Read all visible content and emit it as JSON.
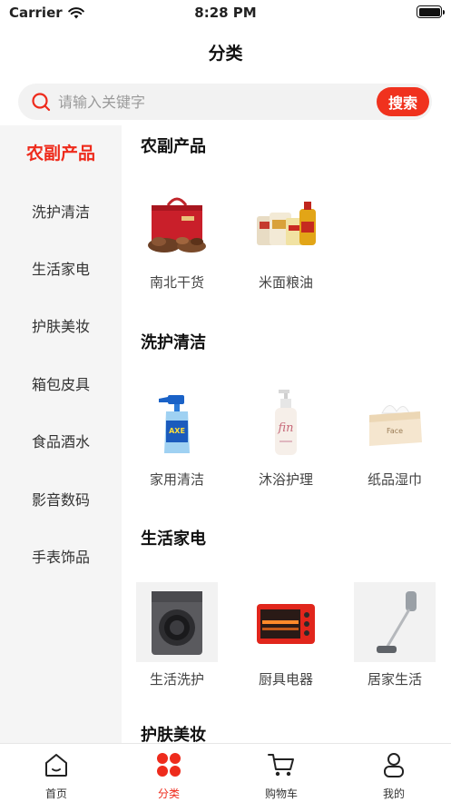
{
  "status_bar": {
    "carrier": "Carrier",
    "time": "8:28 PM"
  },
  "header": {
    "title": "分类"
  },
  "search": {
    "placeholder": "请输入关键字",
    "button_label": "搜索"
  },
  "sidebar": {
    "items": [
      {
        "label": "农副产品",
        "active": true
      },
      {
        "label": "洗护清洁"
      },
      {
        "label": "生活家电"
      },
      {
        "label": "护肤美妆"
      },
      {
        "label": "箱包皮具"
      },
      {
        "label": "食品酒水"
      },
      {
        "label": "影音数码"
      },
      {
        "label": "手表饰品"
      }
    ]
  },
  "sections": [
    {
      "title": "农副产品",
      "products": [
        {
          "label": "南北干货",
          "icon": "gift-box-dried-goods"
        },
        {
          "label": "米面粮油",
          "icon": "rice-flour-oil"
        }
      ]
    },
    {
      "title": "洗护清洁",
      "products": [
        {
          "label": "家用清洁",
          "icon": "spray-bottle"
        },
        {
          "label": "沐浴护理",
          "icon": "pump-bottle"
        },
        {
          "label": "纸品湿巾",
          "icon": "tissue-box"
        }
      ]
    },
    {
      "title": "生活家电",
      "products": [
        {
          "label": "生活洗护",
          "icon": "washing-machine"
        },
        {
          "label": "厨具电器",
          "icon": "toaster-oven"
        },
        {
          "label": "居家生活",
          "icon": "stick-vacuum"
        }
      ]
    },
    {
      "title": "护肤美妆",
      "products": []
    }
  ],
  "tab_bar": {
    "tabs": [
      {
        "label": "首页",
        "icon": "home-icon"
      },
      {
        "label": "分类",
        "icon": "category-icon",
        "active": true
      },
      {
        "label": "购物车",
        "icon": "cart-icon"
      },
      {
        "label": "我的",
        "icon": "user-icon"
      }
    ]
  },
  "colors": {
    "accent": "#ee2b1c",
    "sidebar_bg": "#f5f5f5",
    "search_bg": "#f2f2f2"
  }
}
